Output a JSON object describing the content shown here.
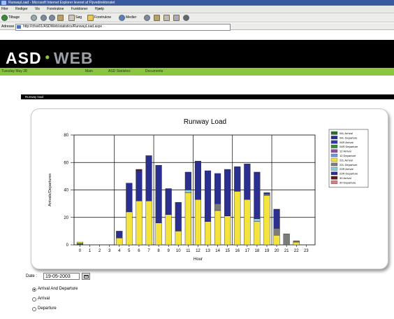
{
  "browser": {
    "title": "RunwayLoad - Microsoft Internet Explorer leveret af Flyvedirektoratet",
    "menu": [
      "Filer",
      "Rediger",
      "Vis",
      "Foretrukne",
      "Funktioner",
      "Hjælp"
    ],
    "toolbar": {
      "back_label": "Tilbage",
      "search_label": "Søg",
      "favorites_label": "Foretrukne",
      "media_label": "Medier"
    },
    "address_label": "Adresse",
    "address_value": "http://cfsw01/ASDWeb/statistics/RunwayLoad.aspx"
  },
  "site": {
    "logo_left": "ASD",
    "logo_dot": "•",
    "logo_right": "WEB",
    "date_text": "Tuesday May 28",
    "nav": [
      "Main",
      "ASD Statistics",
      "Documents"
    ]
  },
  "section_title": "Runway load",
  "chart_data": {
    "type": "bar",
    "stacked": true,
    "title": "Runway Load",
    "xlabel": "Hour",
    "ylabel": "Arrivals/Departures",
    "ylim": [
      0,
      80
    ],
    "yticks": [
      0,
      20,
      40,
      60,
      80
    ],
    "categories": [
      "0",
      "1",
      "2",
      "3",
      "4",
      "5",
      "6",
      "7",
      "8",
      "9",
      "10",
      "11",
      "12",
      "13",
      "14",
      "15",
      "16",
      "17",
      "18",
      "19",
      "20",
      "21",
      "22",
      "23"
    ],
    "grid": true,
    "legend_position": "right",
    "series": [
      {
        "name": "04L Arrival",
        "color": "#2f6b2f",
        "values": [
          1,
          0,
          0,
          0,
          0,
          0,
          0,
          0,
          0,
          0,
          0,
          0,
          0,
          0,
          0,
          0,
          0,
          0,
          0,
          0,
          0,
          0,
          0,
          0
        ]
      },
      {
        "name": "04L Departure",
        "color": "#242f94",
        "values": [
          0,
          0,
          0,
          0,
          0,
          0,
          0,
          0,
          0,
          0,
          0,
          0,
          0,
          0,
          0,
          0,
          0,
          0,
          0,
          0,
          0,
          0,
          0,
          0
        ]
      },
      {
        "name": "04R Arrival",
        "color": "#2b3aa8",
        "values": [
          0,
          0,
          0,
          0,
          0,
          0,
          0,
          0,
          0,
          0,
          0,
          0,
          0,
          0,
          0,
          0,
          0,
          0,
          0,
          0,
          0,
          0,
          0,
          0
        ]
      },
      {
        "name": "04R Departure",
        "color": "#3d8a3d",
        "values": [
          0,
          0,
          0,
          0,
          0,
          0,
          0,
          0,
          0,
          0,
          0,
          0,
          0,
          0,
          0,
          0,
          0,
          0,
          0,
          0,
          0,
          0,
          0,
          0
        ]
      },
      {
        "name": "12 Arrival",
        "color": "#8e4fa0",
        "values": [
          0,
          0,
          0,
          0,
          0,
          0,
          0,
          0,
          0,
          0,
          0,
          0,
          0,
          0,
          0,
          0,
          0,
          0,
          0,
          0,
          0,
          0,
          0,
          0
        ]
      },
      {
        "name": "12 Departure",
        "color": "#6f93d8",
        "values": [
          0,
          0,
          0,
          0,
          0,
          0,
          0,
          0,
          0,
          0,
          0,
          0,
          0,
          0,
          0,
          0,
          0,
          0,
          0,
          0,
          0,
          0,
          0,
          0
        ]
      },
      {
        "name": "22L Arrival",
        "color": "#f4e33c",
        "values": [
          1,
          0,
          0,
          0,
          5,
          24,
          32,
          32,
          16,
          22,
          10,
          38,
          33,
          17,
          25,
          21,
          39,
          33,
          17,
          36,
          7,
          0,
          2,
          0
        ]
      },
      {
        "name": "22L Departure",
        "color": "#7c7c7c",
        "values": [
          0,
          0,
          0,
          0,
          0,
          0,
          0,
          0,
          0,
          0,
          0,
          0,
          0,
          0,
          5,
          0,
          0,
          0,
          0,
          1,
          5,
          8,
          1,
          0
        ]
      },
      {
        "name": "22R Arrival",
        "color": "#8ecad8",
        "values": [
          0,
          0,
          0,
          0,
          0,
          0,
          0,
          0,
          0,
          0,
          0,
          2,
          0,
          0,
          0,
          0,
          0,
          0,
          2,
          0,
          0,
          0,
          0,
          0
        ]
      },
      {
        "name": "22R Departure",
        "color": "#2a2f90",
        "values": [
          0,
          0,
          0,
          0,
          5,
          21,
          22,
          33,
          42,
          19,
          21,
          13,
          28,
          37,
          22,
          34,
          18,
          26,
          34,
          1,
          14,
          0,
          0,
          0
        ]
      },
      {
        "name": "30 Arrival",
        "color": "#5a1e1e",
        "values": [
          0,
          0,
          0,
          0,
          0,
          0,
          1,
          0,
          0,
          0,
          0,
          0,
          0,
          0,
          0,
          0,
          0,
          0,
          0,
          0,
          0,
          0,
          0,
          0
        ]
      },
      {
        "name": "30 Departure",
        "color": "#e07b7b",
        "values": [
          0,
          0,
          0,
          0,
          0,
          0,
          0,
          0,
          0,
          0,
          0,
          0,
          0,
          0,
          0,
          0,
          0,
          0,
          0,
          0,
          0,
          0,
          0,
          0
        ]
      }
    ]
  },
  "form": {
    "date_label": "Date :",
    "date_value": "19-05-2003",
    "radios": [
      {
        "label": "Arrival And Departure",
        "checked": true
      },
      {
        "label": "Arrival",
        "checked": false
      },
      {
        "label": "Departure",
        "checked": false
      }
    ]
  }
}
